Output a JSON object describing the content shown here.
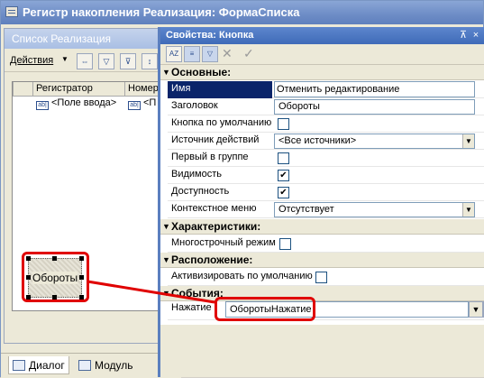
{
  "window": {
    "title": "Регистр накопления Реализация: ФормаСписка"
  },
  "list_window": {
    "title": "Список Реализация",
    "actions_label": "Действия",
    "columns": [
      "Регистратор",
      "Номер"
    ],
    "row_cells": [
      "<Поле ввода>",
      "<П"
    ],
    "button_label": "Обороты"
  },
  "bottom_tabs": [
    "Диалог",
    "Модуль"
  ],
  "properties": {
    "title": "Свойства: Кнопка",
    "controls": {
      "pin": "⊼",
      "close": "×"
    },
    "sections": {
      "main": "Основные:",
      "characteristics": "Характеристики:",
      "placement": "Расположение:",
      "events": "События:"
    },
    "name": {
      "label": "Имя",
      "value": "Отменить редактирование"
    },
    "caption": {
      "label": "Заголовок",
      "value": "Обороты"
    },
    "default_button": {
      "label": "Кнопка по умолчанию",
      "checked": false
    },
    "action_source": {
      "label": "Источник действий",
      "value": "<Все источники>"
    },
    "first_in_group": {
      "label": "Первый в группе",
      "checked": false
    },
    "visibility": {
      "label": "Видимость",
      "checked": true
    },
    "enabled": {
      "label": "Доступность",
      "checked": true
    },
    "context_menu": {
      "label": "Контекстное меню",
      "value": "Отсутствует"
    },
    "multiline": {
      "label": "Многострочный режим",
      "checked": false
    },
    "activate_default": {
      "label": "Активизировать по умолчанию",
      "checked": false
    },
    "press": {
      "label": "Нажатие",
      "value": "ОборотыНажатие"
    }
  },
  "colors": {
    "highlight": "#e00000",
    "selection": "#0a246a",
    "titlebar": "#3f6bb8"
  }
}
